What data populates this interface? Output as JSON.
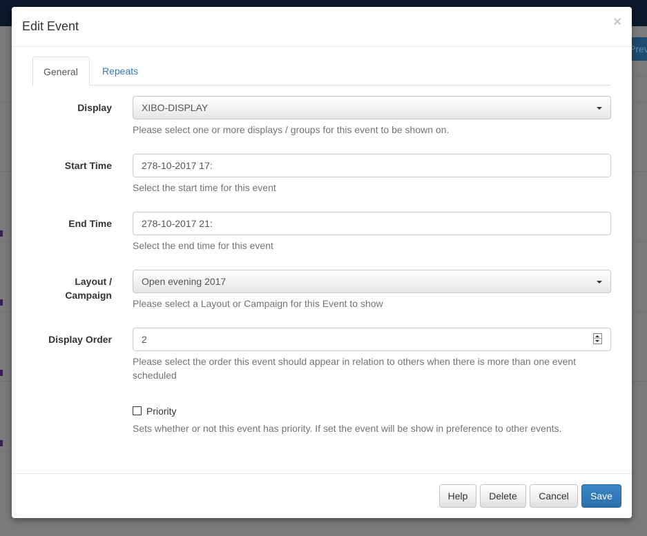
{
  "background": {
    "preview_label": "Prev"
  },
  "modal": {
    "title": "Edit Event",
    "close_glyph": "×"
  },
  "tabs": [
    {
      "label": "General",
      "active": true
    },
    {
      "label": "Repeats",
      "active": false
    }
  ],
  "form": {
    "display": {
      "label": "Display",
      "value": "XIBO-DISPLAY",
      "help": "Please select one or more displays / groups for this event to be shown on."
    },
    "start_time": {
      "label": "Start Time",
      "value": "278-10-2017 17:",
      "help": "Select the start time for this event"
    },
    "end_time": {
      "label": "End Time",
      "value": "278-10-2017 21:",
      "help": "Select the end time for this event"
    },
    "layout_campaign": {
      "label_line1": "Layout /",
      "label_line2": "Campaign",
      "value": "Open evening 2017",
      "help": "Please select a Layout or Campaign for this Event to show"
    },
    "display_order": {
      "label": "Display Order",
      "value": "2",
      "help_line1": "Please select the order this event should appear in relation to others when there is more than one event",
      "help_line2": "scheduled"
    },
    "priority": {
      "label": "Priority",
      "checked": false,
      "help": "Sets whether or not this event has priority. If set the event will be show in preference to other events."
    }
  },
  "footer": {
    "help_label": "Help",
    "delete_label": "Delete",
    "cancel_label": "Cancel",
    "save_label": "Save"
  },
  "colors": {
    "primary": "#337ab7",
    "navbar": "#0c182b",
    "overlay": "#7a7a7a"
  }
}
